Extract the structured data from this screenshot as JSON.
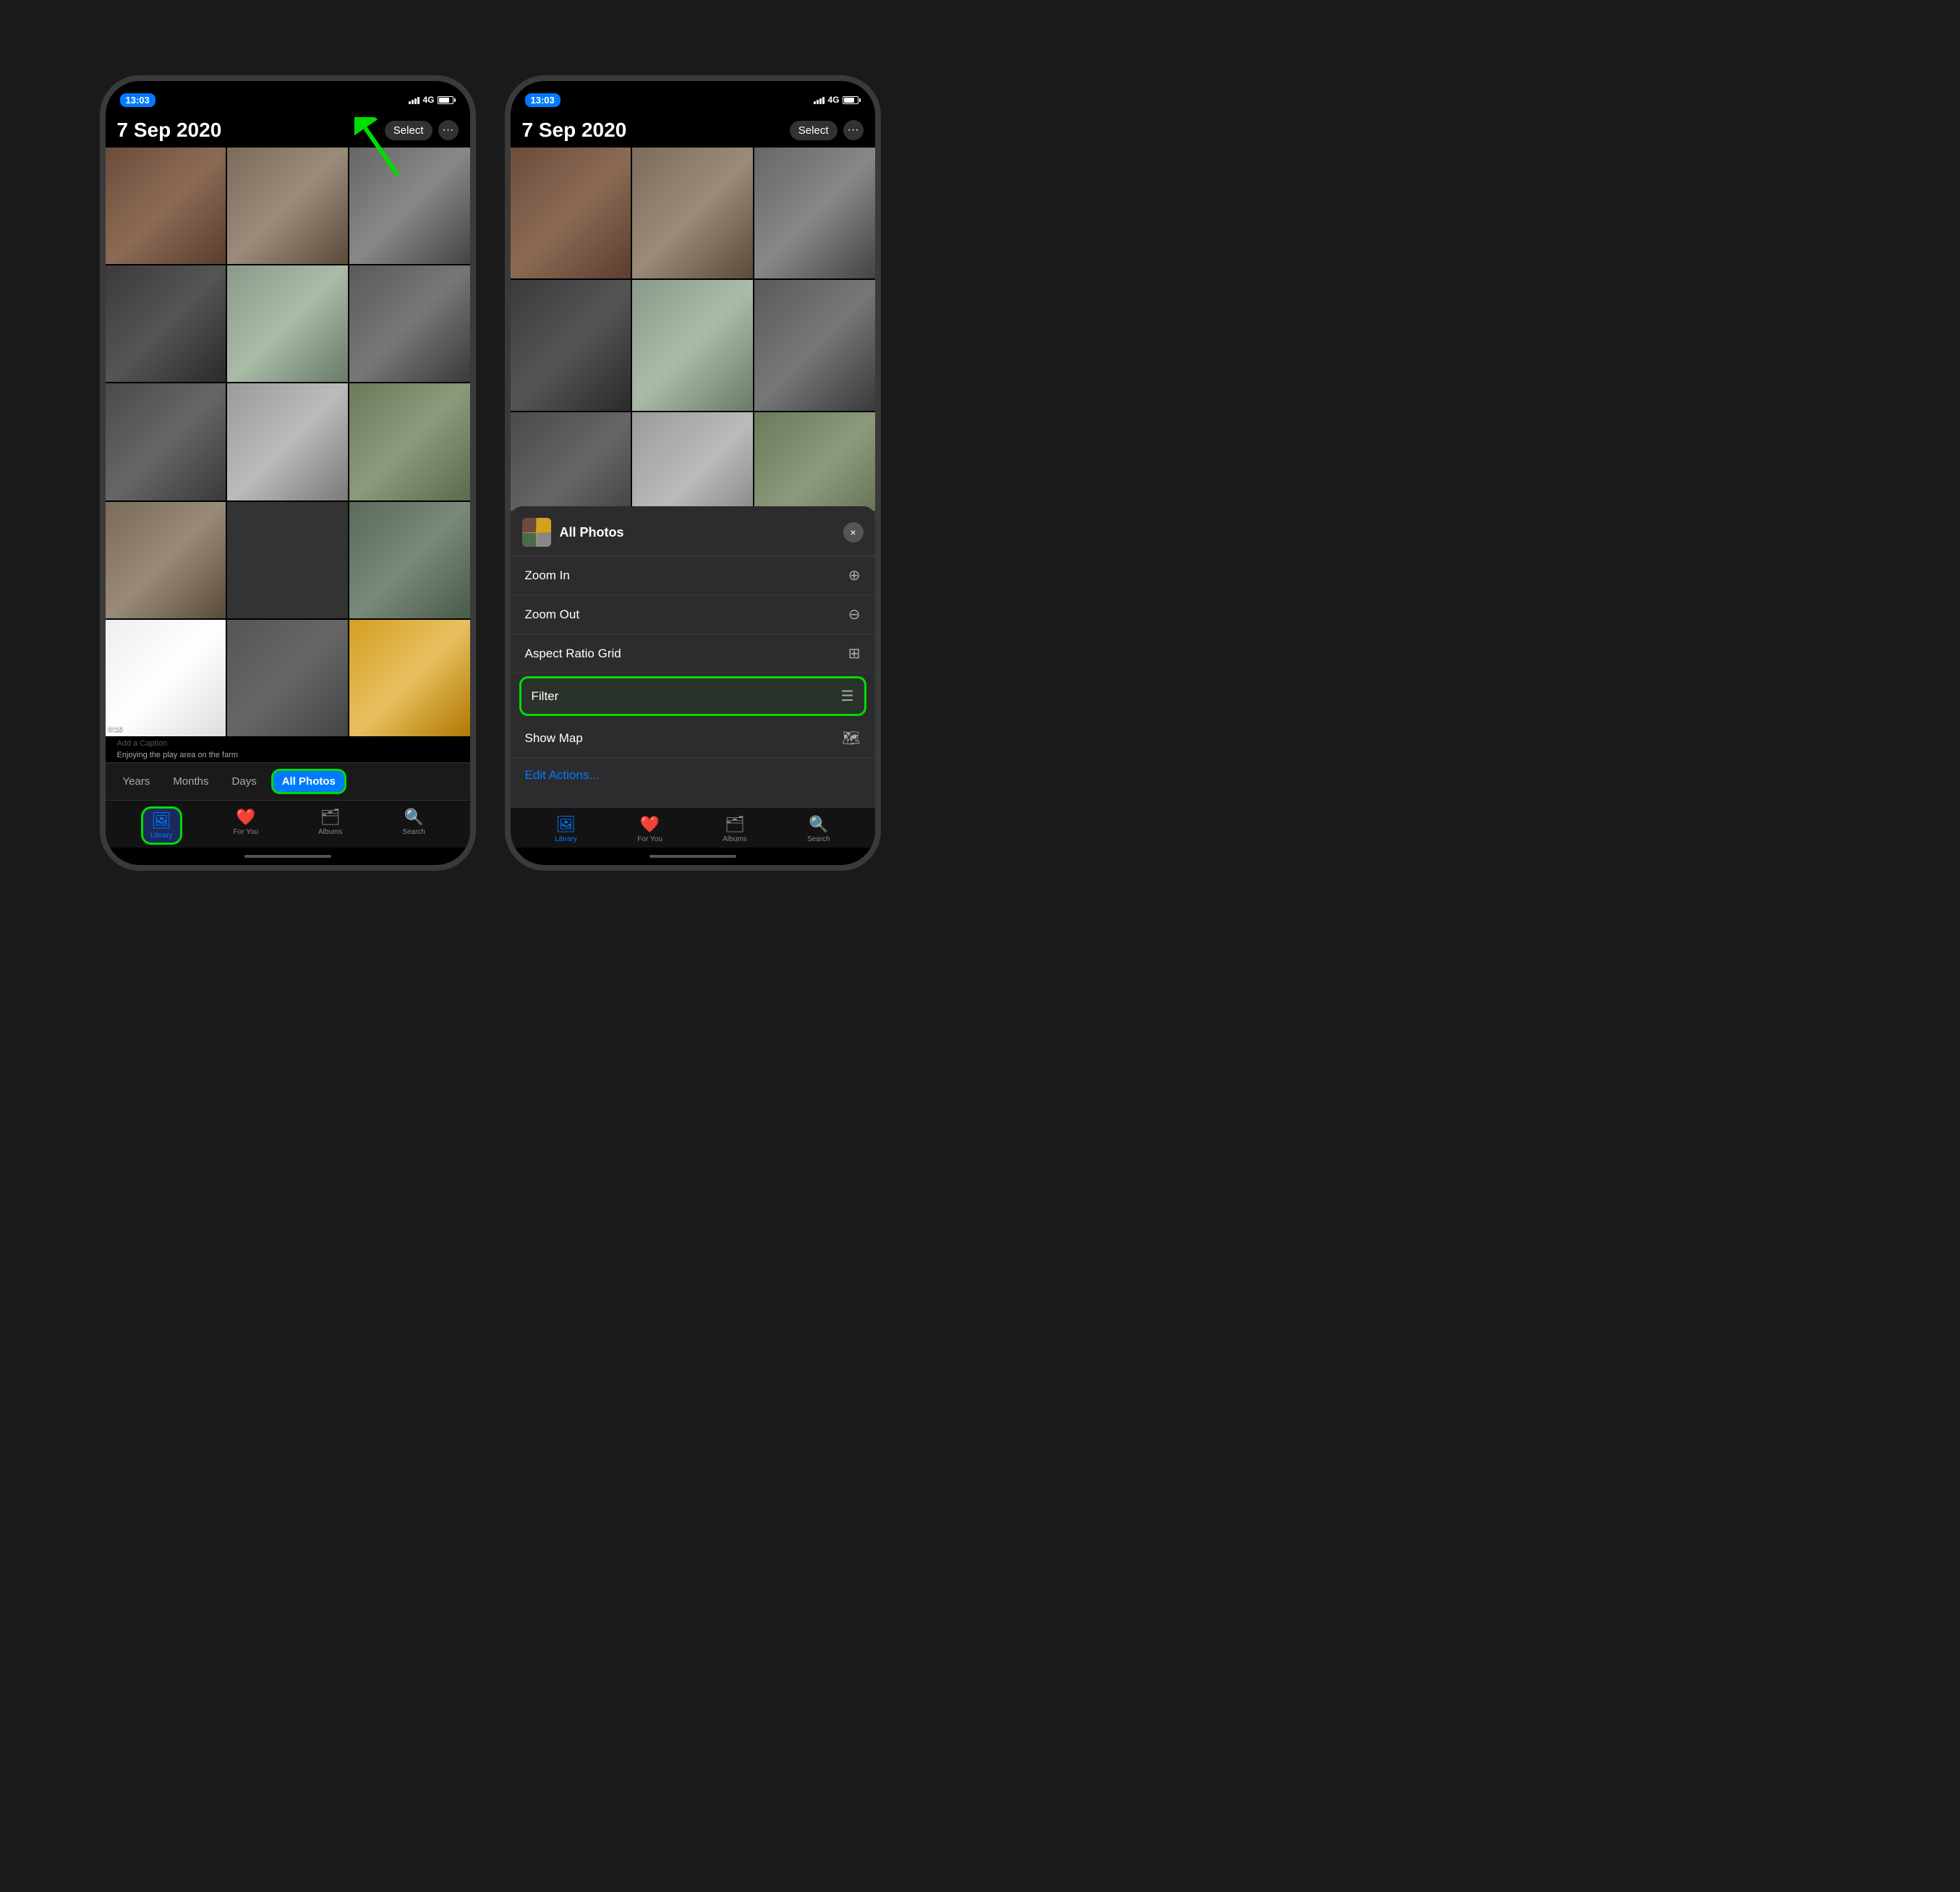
{
  "phones": {
    "left": {
      "status": {
        "time": "13:03",
        "signal": "4G",
        "battery": "full"
      },
      "header": {
        "title": "7 Sep 2020",
        "select_label": "Select",
        "more_label": "···"
      },
      "grid": {
        "rows": 5,
        "cols": 3,
        "cells": [
          {
            "id": 1,
            "type": "photo",
            "colorClass": "cell-1"
          },
          {
            "id": 2,
            "type": "photo",
            "colorClass": "cell-2"
          },
          {
            "id": 3,
            "type": "photo",
            "colorClass": "cell-3"
          },
          {
            "id": 4,
            "type": "photo",
            "colorClass": "cell-4"
          },
          {
            "id": 5,
            "type": "photo",
            "colorClass": "cell-5"
          },
          {
            "id": 6,
            "type": "photo",
            "colorClass": "cell-6"
          },
          {
            "id": 7,
            "type": "photo",
            "colorClass": "cell-7"
          },
          {
            "id": 8,
            "type": "photo",
            "colorClass": "cell-8"
          },
          {
            "id": 9,
            "type": "photo",
            "colorClass": "cell-9"
          },
          {
            "id": 10,
            "type": "photo",
            "colorClass": "cell-10"
          },
          {
            "id": 11,
            "type": "photo",
            "colorClass": "cell-11"
          },
          {
            "id": 12,
            "type": "photo",
            "colorClass": "cell-12"
          },
          {
            "id": 13,
            "type": "photo",
            "colorClass": "cell-13",
            "video_duration": "0:10"
          },
          {
            "id": 14,
            "type": "photo",
            "colorClass": "cell-14"
          },
          {
            "id": 15,
            "type": "photo",
            "colorClass": "cell-15"
          }
        ]
      },
      "caption": "Add a Caption",
      "caption2": "Enjoying the play area on the farm",
      "year_tabs": [
        {
          "label": "Years",
          "selected": false
        },
        {
          "label": "Months",
          "selected": false
        },
        {
          "label": "Days",
          "selected": false
        },
        {
          "label": "All Photos",
          "selected": true
        }
      ],
      "bottom_nav": [
        {
          "label": "Library",
          "icon": "🖼",
          "active": true
        },
        {
          "label": "For You",
          "icon": "❤️",
          "active": false
        },
        {
          "label": "Albums",
          "icon": "🗂",
          "active": false
        },
        {
          "label": "Search",
          "icon": "🔍",
          "active": false
        }
      ]
    },
    "right": {
      "status": {
        "time": "13:03",
        "signal": "4G",
        "battery": "full"
      },
      "header": {
        "title": "7 Sep 2020",
        "select_label": "Select",
        "more_label": "···"
      },
      "bottom_sheet": {
        "album_title": "All Photos",
        "close_label": "×",
        "menu_items": [
          {
            "label": "Zoom In",
            "icon": "⊕",
            "id": "zoom-in",
            "highlighted": false
          },
          {
            "label": "Zoom Out",
            "icon": "⊖",
            "id": "zoom-out",
            "highlighted": false
          },
          {
            "label": "Aspect Ratio Grid",
            "icon": "⊞",
            "id": "aspect-ratio-grid",
            "highlighted": false
          },
          {
            "label": "Filter",
            "icon": "≡",
            "id": "filter",
            "highlighted": true
          },
          {
            "label": "Show Map",
            "icon": "🗺",
            "id": "show-map",
            "highlighted": false
          }
        ],
        "edit_actions_label": "Edit Actions..."
      },
      "bottom_nav": [
        {
          "label": "Library",
          "icon": "🖼",
          "active": true
        },
        {
          "label": "For You",
          "icon": "❤️",
          "active": false
        },
        {
          "label": "Albums",
          "icon": "🗂",
          "active": false
        },
        {
          "label": "Search",
          "icon": "🔍",
          "active": false
        }
      ]
    }
  },
  "annotation": {
    "arrow_color": "#00dd00"
  }
}
